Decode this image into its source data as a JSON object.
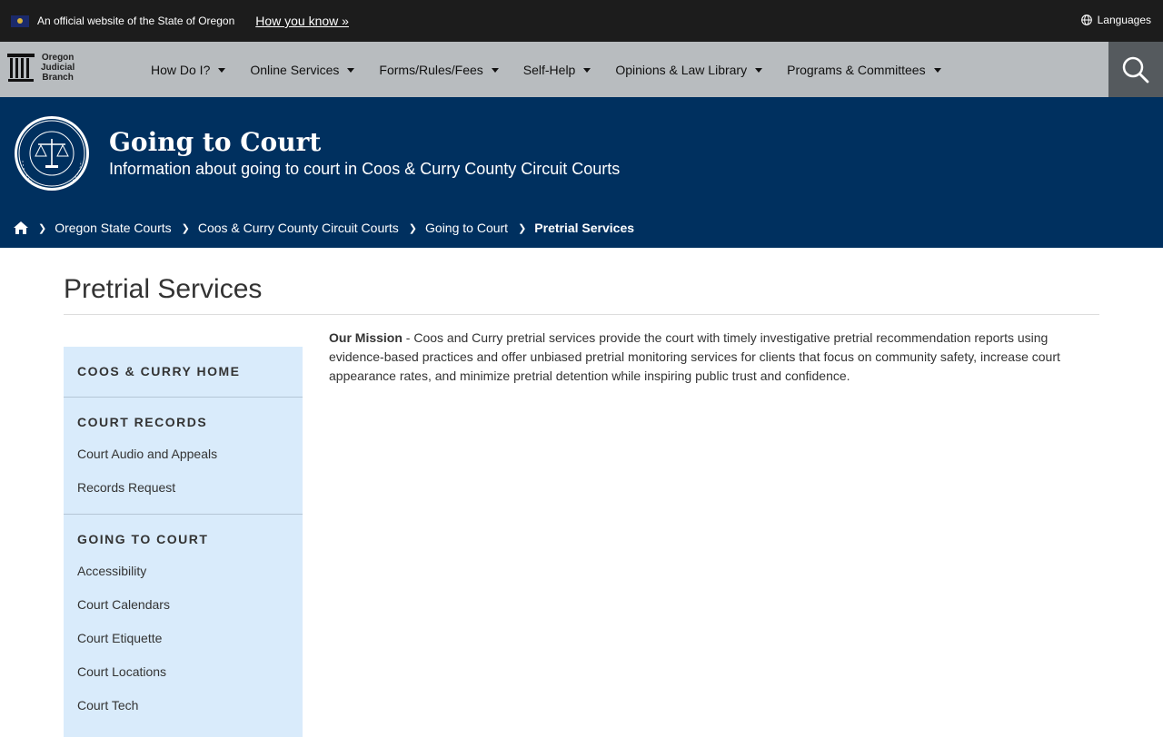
{
  "gov_banner": {
    "text": "An official website of the State of Oregon",
    "link": "How you know »",
    "languages": "Languages"
  },
  "logo": {
    "line1": "Oregon",
    "line2": "Judicial",
    "line3": "Branch"
  },
  "nav": {
    "items": [
      {
        "label": "How Do I?"
      },
      {
        "label": "Online Services"
      },
      {
        "label": "Forms/Rules/Fees"
      },
      {
        "label": "Self-Help"
      },
      {
        "label": "Opinions & Law Library"
      },
      {
        "label": "Programs & Committees"
      }
    ]
  },
  "hero": {
    "title": "Going to Court",
    "subtitle": "Information about going to court in Coos & Curry County Circuit Courts"
  },
  "breadcrumb": {
    "items": [
      "Oregon State Courts",
      "Coos & Curry County Circuit Courts",
      "Going to Court"
    ],
    "current": "Pretrial Services"
  },
  "page": {
    "title": "Pretrial Services",
    "mission_label": "Our Mission",
    "mission_text": " - Coos and Curry pretrial services provide the court with timely investigative pretrial recommendation reports using evidence-based practices and offer unbiased pretrial monitoring services for clients that focus on community safety, increase court appearance rates, and minimize pretrial detention while inspiring public trust and confidence."
  },
  "sidebar": {
    "sections": [
      {
        "heading": "COOS & CURRY HOME",
        "links": []
      },
      {
        "heading": "COURT RECORDS",
        "links": [
          "Court Audio and Appeals",
          "Records Request"
        ]
      },
      {
        "heading": "GOING TO COURT",
        "links": [
          "Accessibility",
          "Court Calendars",
          "Court Etiquette",
          "Court Locations",
          "Court Tech"
        ]
      }
    ]
  },
  "colors": {
    "hero_bg": "#00305f",
    "nav_bg": "#b8bcbf",
    "sidebar_bg": "#d9ebfb",
    "banner_bg": "#1c1c1c"
  }
}
